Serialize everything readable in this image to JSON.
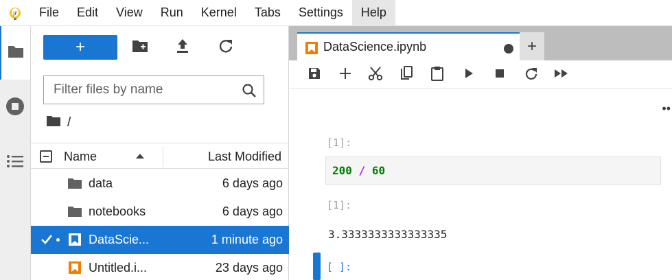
{
  "menubar": {
    "logo_icon": "jupyter-logo-icon",
    "items": [
      "File",
      "Edit",
      "View",
      "Run",
      "Kernel",
      "Tabs",
      "Settings",
      "Help"
    ],
    "active_item": "Help"
  },
  "activity_bar": {
    "items": [
      {
        "name": "file-browser",
        "icon": "folder-icon"
      },
      {
        "name": "running-kernels",
        "icon": "stop-circle-icon"
      },
      {
        "name": "table-of-contents",
        "icon": "list-icon"
      }
    ]
  },
  "file_browser": {
    "new_button_label": "+",
    "filter_placeholder": "Filter files by name",
    "filter_value": "",
    "breadcrumb": "/",
    "columns": {
      "name": "Name",
      "modified": "Last Modified"
    },
    "rows": [
      {
        "type": "folder",
        "name": "data",
        "modified": "6 days ago",
        "selected": false
      },
      {
        "type": "folder",
        "name": "notebooks",
        "modified": "6 days ago",
        "selected": false
      },
      {
        "type": "notebook",
        "name": "DataScie...",
        "modified": "1 minute ago",
        "selected": true
      },
      {
        "type": "notebook",
        "name": "Untitled.i...",
        "modified": "23 days ago",
        "selected": false
      }
    ]
  },
  "notebook": {
    "tab_title": "DataScience.ipynb",
    "tab_add_label": "+",
    "toolbar": [
      "save",
      "insert-cell",
      "cut",
      "copy",
      "paste",
      "run",
      "stop",
      "restart",
      "run-all"
    ],
    "toolbar_more": "••",
    "cells": {
      "input_prompt": "[1]:",
      "code_num1": "200",
      "code_op": "/",
      "code_num2": "60",
      "output_prompt": "[1]:",
      "output_text": "3.3333333333333335",
      "empty_prompt": "[ ]:"
    }
  },
  "colors": {
    "accent": "#1976d2",
    "notebook_icon": "#f57c00"
  }
}
